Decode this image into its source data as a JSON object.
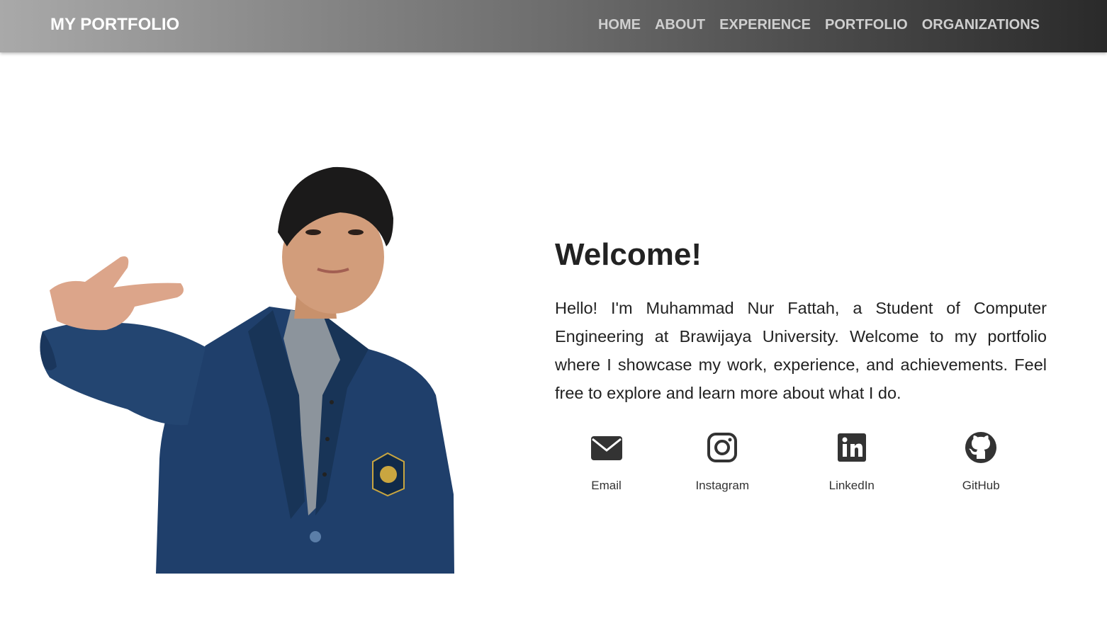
{
  "navbar": {
    "brand": "MY PORTFOLIO",
    "links": [
      {
        "label": "HOME"
      },
      {
        "label": "ABOUT"
      },
      {
        "label": "EXPERIENCE"
      },
      {
        "label": "PORTFOLIO"
      },
      {
        "label": "ORGANIZATIONS"
      }
    ]
  },
  "hero": {
    "photo_icon": "person-portrait",
    "heading": "Welcome!",
    "intro": "Hello! I'm Muhammad Nur Fattah, a Student of Computer Engineering at Brawijaya University. Welcome to my portfolio where I showcase my work, experience, and achievements. Feel free to explore and learn more about what I do."
  },
  "socials": [
    {
      "label": "Email",
      "icon": "envelope-icon"
    },
    {
      "label": "Instagram",
      "icon": "instagram-icon"
    },
    {
      "label": "LinkedIn",
      "icon": "linkedin-icon"
    },
    {
      "label": "GitHub",
      "icon": "github-icon"
    }
  ],
  "colors": {
    "text": "#222222",
    "icon": "#333333",
    "nav_link": "#cfcfcf",
    "jacket": "#1f3f6b"
  }
}
